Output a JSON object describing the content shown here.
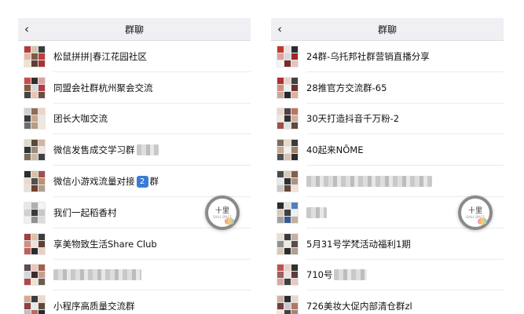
{
  "left": {
    "title": "群聊",
    "back": "‹",
    "groups": [
      {
        "name": "松鼠拼拼|春江花园社区",
        "blur_after": 0,
        "colors": [
          "#b33a3a",
          "#d8c6a8",
          "#3c3c3c",
          "#e6b8a2",
          "#7a5c48",
          "#c23b3b",
          "#f0e0d0",
          "#5d4037",
          "#a83232"
        ]
      },
      {
        "name": "同盟会社群杭州聚会交流",
        "blur_after": 0,
        "colors": [
          "#c94c4c",
          "#2f2f2f",
          "#e0a0a0",
          "#8b5a3c",
          "#d9d9d9",
          "#b03a48",
          "#444444",
          "#e8c4b8",
          "#6b4f3f"
        ]
      },
      {
        "name": "团长大咖交流",
        "blur_after": 0,
        "colors": [
          "#d0d0d0",
          "#8a6d5b",
          "#f2d0c4",
          "#3b3b3b",
          "#c9a98c",
          "#e8e8e8",
          "#6d6d6d",
          "#b89c84",
          "#f5e6da"
        ]
      },
      {
        "name": "微信发售成交学习群",
        "blur_after": 28,
        "colors": [
          "#e0d8c8",
          "#5a4a3a",
          "#d4b49c",
          "#333333",
          "#9c8c7c",
          "#f0e8e0",
          "#7c6c5c",
          "#c8b8a8",
          "#404040"
        ]
      },
      {
        "name": "微信小游戏流量对接",
        "emoji": "2",
        "suffix": "群",
        "blur_after": 0,
        "colors": [
          "#2d2d2d",
          "#d8c0a8",
          "#a05050",
          "#f0d8c8",
          "#505050",
          "#c09070",
          "#e8e0d8",
          "#704030",
          "#b0a090"
        ]
      },
      {
        "name": "我们一起稻香村",
        "blur_after": 0,
        "colors": [
          "#e8e8e8",
          "#b0b0b0",
          "#f4f4f4",
          "#d0d0d0",
          "#3a3a3a",
          "#c8c8c8",
          "#f0f0f0",
          "#909090",
          "#dcdcdc"
        ]
      },
      {
        "name": "享美物致生活Share Club",
        "blur_after": 0,
        "colors": [
          "#a04040",
          "#e0c0b0",
          "#3c3c3c",
          "#d09080",
          "#f0e0d8",
          "#604030",
          "#c06060",
          "#2c2c2c",
          "#e8d0c0"
        ]
      },
      {
        "name": "",
        "blur_after": 112,
        "colors": [
          "#5c4c4c",
          "#e8c8b8",
          "#a06050",
          "#d8d8d8",
          "#3c2c2c",
          "#c8a088",
          "#b04848",
          "#f0e0d0",
          "#6c5c4c"
        ]
      },
      {
        "name": "小程序高质量交流群",
        "blur_after": 0,
        "colors": [
          "#d8a890",
          "#3c3c3c",
          "#f0d8c8",
          "#904040",
          "#e8e8e8",
          "#5c4c3c",
          "#c0c0c0",
          "#b07060",
          "#282828"
        ]
      }
    ]
  },
  "right": {
    "title": "群聊",
    "back": "‹",
    "groups": [
      {
        "name": "24群-乌托邦社群营销直播分享",
        "blur_after": 0,
        "colors": [
          "#c0392b",
          "#f0e0e0",
          "#2c2c2c",
          "#e0a0a0",
          "#d8d8d8",
          "#a02828",
          "#f5f5f5",
          "#7a2a2a",
          "#e8c0c0"
        ]
      },
      {
        "name": "28推官方交流群-65",
        "blur_after": 0,
        "colors": [
          "#b03030",
          "#e8d0c8",
          "#404040",
          "#d09080",
          "#f0f0f0",
          "#703030",
          "#c8a898",
          "#282828",
          "#e0b0a0"
        ]
      },
      {
        "name": "30天打造抖音千万粉-2",
        "blur_after": 0,
        "colors": [
          "#e8d8c8",
          "#504040",
          "#c07060",
          "#f0e8e0",
          "#303030",
          "#d0b0a0",
          "#a05048",
          "#e0e0e0",
          "#604840"
        ]
      },
      {
        "name": "40起来NŌME",
        "blur_after": 0,
        "colors": [
          "#7c6c5c",
          "#e8d8c8",
          "#3a3a3a",
          "#c8a890",
          "#f0f0f0",
          "#a08070",
          "#505050",
          "#d8c0b0",
          "#2c2c2c"
        ]
      },
      {
        "name": "",
        "blur_after": 160,
        "colors": [
          "#4a4a4a",
          "#d8c8b8",
          "#806050",
          "#e8e8e8",
          "#303030",
          "#b09080",
          "#c8c8c8",
          "#604838",
          "#f0e0d8"
        ]
      },
      {
        "name": "",
        "blur_after": 26,
        "colors": [
          "#2c2c2c",
          "#e0e0e0",
          "#5080c0",
          "#d8c8b8",
          "#404040",
          "#f0f0f0",
          "#a0a0a0",
          "#3a5a8a",
          "#c0b0a0"
        ]
      },
      {
        "name": "5月31号学梵活动福利1期",
        "blur_after": 0,
        "colors": [
          "#e8e0d8",
          "#3c3c3c",
          "#c8b0a0",
          "#909090",
          "#f0e8e0",
          "#5c4c4c",
          "#d8c8b8",
          "#2c2c2c",
          "#b0a090"
        ]
      },
      {
        "name": "710号",
        "blur_after": 42,
        "colors": [
          "#c05050",
          "#e8d0c8",
          "#303030",
          "#a06060",
          "#f0e0e0",
          "#5c3c3c",
          "#d8a8a0",
          "#404040",
          "#e8c8c0"
        ]
      },
      {
        "name": "726美妆大促内部清仓群zl",
        "blur_after": 0,
        "colors": [
          "#d0b0a0",
          "#2c2c2c",
          "#e8d8c8",
          "#704040",
          "#c8c8c8",
          "#b07868",
          "#f0e8e0",
          "#4c3c3c",
          "#a08878"
        ]
      }
    ]
  },
  "badge": {
    "title": "十里",
    "subtitle": "SHILI SPACE"
  }
}
